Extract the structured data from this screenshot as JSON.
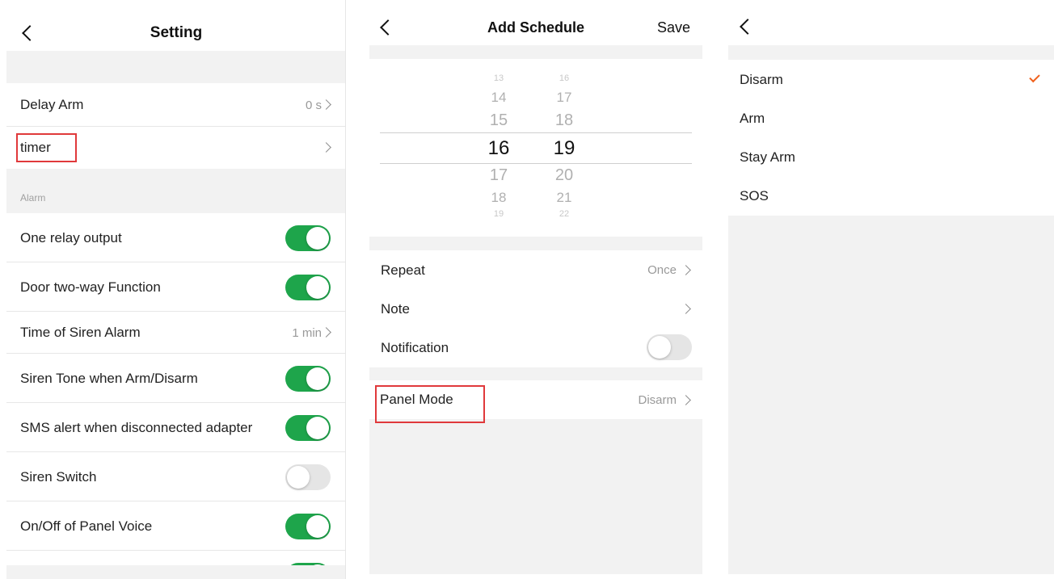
{
  "screen1": {
    "title": "Setting",
    "rows": {
      "delay_arm": {
        "label": "Delay Arm",
        "value": "0 s"
      },
      "timer": {
        "label": "timer"
      }
    },
    "section_alarm": "Alarm",
    "toggles": [
      {
        "label": "One relay output",
        "state": "on"
      },
      {
        "label": "Door two-way Function",
        "state": "on"
      },
      {
        "label": "Time of Siren Alarm",
        "value": "1 min"
      },
      {
        "label": "Siren Tone when Arm/Disarm",
        "state": "on"
      },
      {
        "label": "SMS alert when disconnected adapter",
        "state": "on"
      },
      {
        "label": "Siren Switch",
        "state": "off"
      },
      {
        "label": "On/Off of Panel Voice",
        "state": "on"
      }
    ]
  },
  "screen2": {
    "title": "Add Schedule",
    "save_label": "Save",
    "picker": {
      "hours": [
        "13",
        "14",
        "15",
        "16",
        "17",
        "18",
        "19"
      ],
      "minutes": [
        "16",
        "17",
        "18",
        "19",
        "20",
        "21",
        "22"
      ],
      "selected_hour": "16",
      "selected_minute": "19"
    },
    "repeat": {
      "label": "Repeat",
      "value": "Once"
    },
    "note": {
      "label": "Note"
    },
    "notification": {
      "label": "Notification",
      "state": "off"
    },
    "panel_mode": {
      "label": "Panel Mode",
      "value": "Disarm"
    }
  },
  "screen3": {
    "options": [
      "Disarm",
      "Arm",
      "Stay Arm",
      "SOS"
    ],
    "selected": "Disarm"
  },
  "colors": {
    "toggle_on": "#1ea54b",
    "highlight": "#e0393b",
    "check": "#f0611c"
  }
}
